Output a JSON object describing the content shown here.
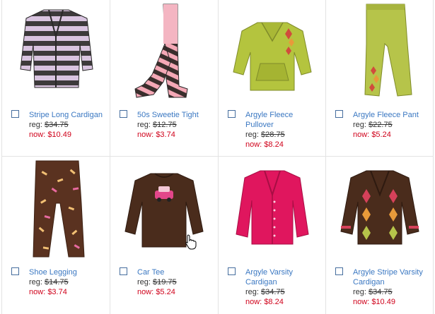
{
  "labels": {
    "reg": "reg:",
    "now": "now:"
  },
  "products": [
    {
      "name": "Stripe Long Cardigan",
      "reg": "$34.75",
      "now": "$10.49",
      "icon": "striped-cardigan-icon"
    },
    {
      "name": "50s Sweetie Tight",
      "reg": "$12.75",
      "now": "$3.74",
      "icon": "striped-tights-icon"
    },
    {
      "name": "Argyle Fleece Pullover",
      "reg": "$28.75",
      "now": "$8.24",
      "icon": "fleece-pullover-icon"
    },
    {
      "name": "Argyle Fleece Pant",
      "reg": "$22.75",
      "now": "$5.24",
      "icon": "fleece-pant-icon"
    },
    {
      "name": "Shoe Legging",
      "reg": "$14.75",
      "now": "$3.74",
      "icon": "legging-icon"
    },
    {
      "name": "Car Tee",
      "reg": "$19.75",
      "now": "$5.24",
      "icon": "car-tee-icon"
    },
    {
      "name": "Argyle Varsity Cardigan",
      "reg": "$34.75",
      "now": "$8.24",
      "icon": "pink-cardigan-icon"
    },
    {
      "name": "Argyle Stripe Varsity Cardigan",
      "reg": "$34.75",
      "now": "$10.49",
      "icon": "argyle-cardigan-icon"
    }
  ]
}
